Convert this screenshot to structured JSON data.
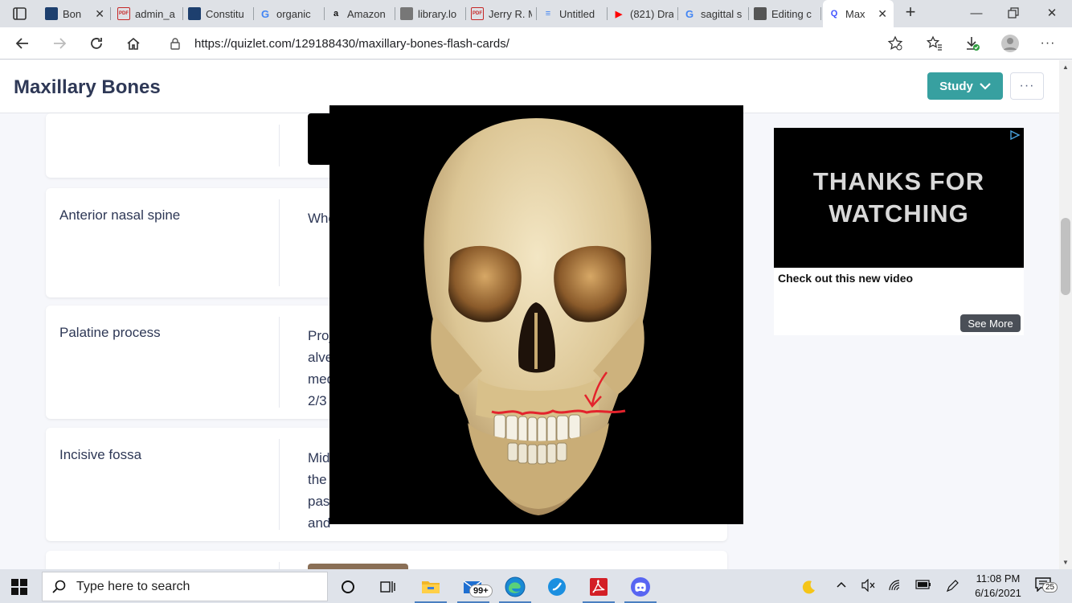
{
  "browser": {
    "tabs": [
      {
        "title": "Bon",
        "favicon": "app-icon",
        "fav_text": "",
        "fav_color": "#1d3f6e",
        "closable": true
      },
      {
        "title": "admin_a",
        "favicon": "pdf-icon",
        "fav_text": "PDF",
        "fav_color": "#c62828"
      },
      {
        "title": "Constitu",
        "favicon": "app-icon",
        "fav_text": "",
        "fav_color": "#1d3f6e"
      },
      {
        "title": "organic",
        "favicon": "google-icon",
        "fav_text": "G",
        "fav_color": "#4285f4"
      },
      {
        "title": "Amazon",
        "favicon": "amazon-icon",
        "fav_text": "a",
        "fav_color": "#111111"
      },
      {
        "title": "library.lo",
        "favicon": "page-icon",
        "fav_text": "",
        "fav_color": "#777777"
      },
      {
        "title": "Jerry R. M",
        "favicon": "pdf-icon",
        "fav_text": "PDF",
        "fav_color": "#c62828"
      },
      {
        "title": "Untitled",
        "favicon": "docs-icon",
        "fav_text": "≡",
        "fav_color": "#4285f4"
      },
      {
        "title": "(821) Dra",
        "favicon": "youtube-icon",
        "fav_text": "▶",
        "fav_color": "#ff0000"
      },
      {
        "title": "sagittal s",
        "favicon": "google-icon",
        "fav_text": "G",
        "fav_color": "#4285f4"
      },
      {
        "title": "Editing c",
        "favicon": "app-icon",
        "fav_text": "",
        "fav_color": "#555555"
      },
      {
        "title": "Max",
        "favicon": "quizlet-icon",
        "fav_text": "Q",
        "fav_color": "#4255ff",
        "active": true,
        "closable": true
      }
    ],
    "url": "https://quizlet.com/129188430/maxillary-bones-flash-cards/"
  },
  "page": {
    "title": "Maxillary Bones",
    "study_label": "Study",
    "more_label": "···"
  },
  "cards": [
    {
      "term": "",
      "definition": ""
    },
    {
      "term": "Anterior nasal spine",
      "definition": "Whe"
    },
    {
      "term": "Palatine process",
      "definition_lines": [
        "Proj",
        "alve",
        "med",
        "2/3"
      ]
    },
    {
      "term": "Incisive fossa",
      "definition_lines": [
        "Mid",
        "the",
        "pas",
        "and"
      ]
    }
  ],
  "ad": {
    "video_text": "THANKS FOR WATCHING",
    "caption": "Check out this new video",
    "see_more": "See More"
  },
  "taskbar": {
    "search_placeholder": "Type here to search",
    "mail_badge": "99+",
    "time": "11:08 PM",
    "date": "6/16/2021",
    "notification_count": "25"
  },
  "colors": {
    "study_button": "#37a0a0",
    "page_bg": "#f6f7fb",
    "title_text": "#2e3856"
  }
}
